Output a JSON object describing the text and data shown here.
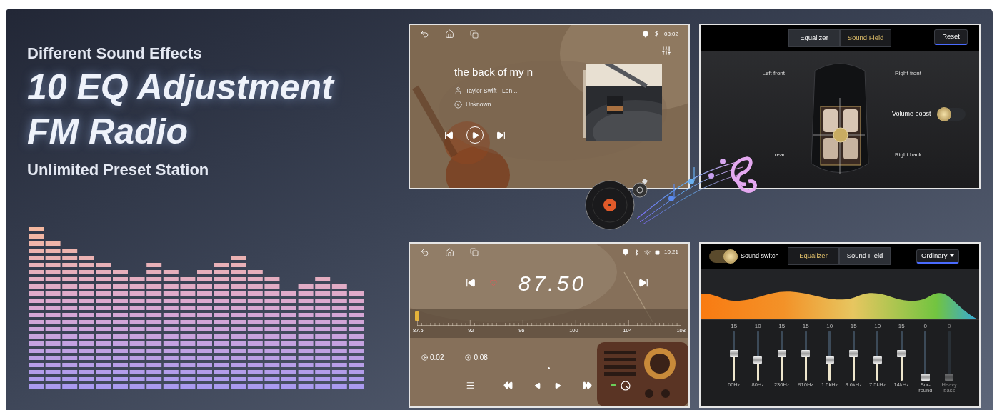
{
  "headline": {
    "kicker": "Different Sound Effects",
    "titles": [
      "10 EQ Adjustment",
      "FM Radio"
    ],
    "subtitle": "Unlimited Preset Station"
  },
  "music_screen": {
    "time": "08:02",
    "title": "the back of my n",
    "artist": "Taylor Swift - Lon...",
    "album": "Unknown",
    "playing": false
  },
  "sound_field_screen": {
    "tabs": [
      {
        "label": "Equalizer",
        "selected": false
      },
      {
        "label": "Sound Field",
        "selected": true
      }
    ],
    "reset": "Reset",
    "speakers": [
      "Left front",
      "Right front",
      "rear",
      "Right back"
    ],
    "volume_boost": {
      "label": "Volume boost",
      "on": false
    }
  },
  "radio_screen": {
    "time": "10:21",
    "frequency": "87.50",
    "favorite": false,
    "tuner": {
      "level": 0,
      "labels": [
        "87.5",
        "92",
        "96",
        "100",
        "104",
        "108"
      ]
    },
    "presets": [
      "0.02",
      "0.08"
    ]
  },
  "eq_screen": {
    "sound_switch": {
      "label": "Sound switch",
      "on": true
    },
    "tabs": [
      {
        "label": "Equalizer",
        "selected": true
      },
      {
        "label": "Sound Field",
        "selected": false
      }
    ],
    "preset": "Ordinary",
    "bands": [
      {
        "value": "15",
        "label": "60Hz",
        "level": 0.55,
        "disabled": false
      },
      {
        "value": "10",
        "label": "80Hz",
        "level": 0.4,
        "disabled": false
      },
      {
        "value": "15",
        "label": "230Hz",
        "level": 0.55,
        "disabled": false
      },
      {
        "value": "15",
        "label": "910Hz",
        "level": 0.55,
        "disabled": false
      },
      {
        "value": "10",
        "label": "1.5kHz",
        "level": 0.4,
        "disabled": false
      },
      {
        "value": "15",
        "label": "3.6kHz",
        "level": 0.55,
        "disabled": false
      },
      {
        "value": "10",
        "label": "7.5kHz",
        "level": 0.4,
        "disabled": false
      },
      {
        "value": "15",
        "label": "14kHz",
        "level": 0.55,
        "disabled": false
      },
      {
        "value": "0",
        "label": "Sur-round",
        "level": 0,
        "disabled": false
      },
      {
        "value": "0",
        "label": "Heavy bass",
        "level": 0,
        "disabled": true
      }
    ]
  }
}
